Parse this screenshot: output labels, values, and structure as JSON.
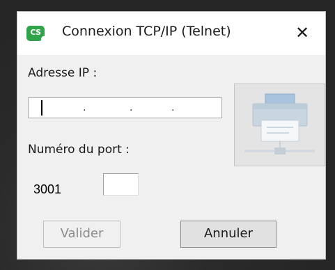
{
  "dialog": {
    "title": "Connexion TCP/IP (Telnet)",
    "app_icon_text": "CS",
    "close_symbol": "✕"
  },
  "form": {
    "ip_label": "Adresse IP :",
    "ip_dots": [
      ".",
      ".",
      "."
    ],
    "port_label": "Numéro du port :",
    "port_value": "3001",
    "port_field_value": ""
  },
  "buttons": {
    "valider": "Valider",
    "annuler": "Annuler"
  },
  "icons": {
    "app": "cs-app-icon",
    "close": "close-icon",
    "printer": "network-printer-icon"
  },
  "colors": {
    "app_icon_green": "#2fa44a",
    "dialog_bg": "#f0f0f0",
    "titlebar_bg": "#ffffff",
    "printer_blue": "#a8c4dd"
  }
}
